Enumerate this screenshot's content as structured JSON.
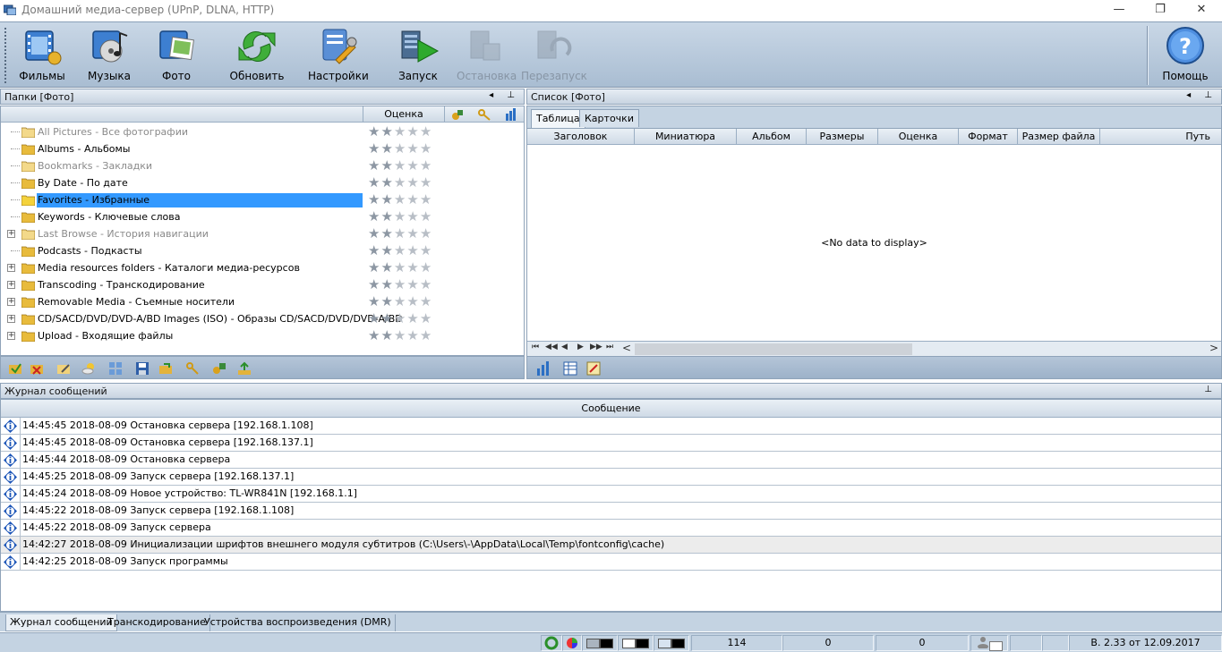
{
  "window": {
    "title": "Домашний медиа-сервер (UPnP, DLNA, HTTP)",
    "minimize": "—",
    "restore": "❐",
    "close": "✕"
  },
  "toolbar": {
    "movies": "Фильмы",
    "music": "Музыка",
    "photo": "Фото",
    "refresh": "Обновить",
    "settings": "Настройки",
    "start": "Запуск",
    "stop": "Остановка",
    "restart": "Перезапуск",
    "help": "Помощь"
  },
  "left_panel": {
    "header": "Папки [Фото]",
    "rating_column": "Оценка",
    "items": [
      {
        "label": "All Pictures - Все фотографии",
        "grey": true,
        "expandable": false,
        "rating": 2
      },
      {
        "label": "Albums - Альбомы",
        "grey": false,
        "expandable": false,
        "rating": 2
      },
      {
        "label": "Bookmarks - Закладки",
        "grey": true,
        "expandable": false,
        "rating": 2
      },
      {
        "label": "By Date - По дате",
        "grey": false,
        "expandable": false,
        "rating": 2
      },
      {
        "label": "Favorites - Избранные",
        "grey": false,
        "expandable": false,
        "rating": 2,
        "selected": true
      },
      {
        "label": "Keywords - Ключевые слова",
        "grey": false,
        "expandable": false,
        "rating": 2
      },
      {
        "label": "Last Browse - История навигации",
        "grey": true,
        "expandable": true,
        "rating": 2
      },
      {
        "label": "Podcasts - Подкасты",
        "grey": false,
        "expandable": false,
        "rating": 2
      },
      {
        "label": "Media resources folders - Каталоги медиа-ресурсов",
        "grey": false,
        "expandable": true,
        "rating": 2
      },
      {
        "label": "Transcoding - Транскодирование",
        "grey": false,
        "expandable": true,
        "rating": 2
      },
      {
        "label": "Removable Media - Съемные носители",
        "grey": false,
        "expandable": true,
        "rating": 2
      },
      {
        "label": "CD/SACD/DVD/DVD-A/BD Images (ISO) - Образы CD/SACD/DVD/DVD-A/BD",
        "grey": false,
        "expandable": true,
        "rating": 2
      },
      {
        "label": "Upload - Входящие файлы",
        "grey": false,
        "expandable": true,
        "rating": 2
      }
    ]
  },
  "right_panel": {
    "header": "Список [Фото]",
    "tabs": [
      "Таблица",
      "Карточки"
    ],
    "columns": [
      "Заголовок",
      "Миниатюра",
      "Альбом",
      "Размеры",
      "Оценка",
      "Формат",
      "Размер файла",
      "Путь"
    ],
    "empty_text": "<No data to display>",
    "nav": [
      "⏮",
      "◀◀",
      "◀",
      "▶",
      "▶▶",
      "⏭",
      "<",
      ">"
    ]
  },
  "log": {
    "header": "Журнал сообщений",
    "column": "Сообщение",
    "rows": [
      "14:45:45 2018-08-09 Остановка сервера [192.168.1.108]",
      "14:45:45 2018-08-09 Остановка сервера [192.168.137.1]",
      "14:45:44 2018-08-09 Остановка сервера",
      "14:45:25 2018-08-09 Запуск сервера [192.168.137.1]",
      "14:45:24 2018-08-09 Новое устройство: TL-WR841N [192.168.1.1]",
      "14:45:22 2018-08-09 Запуск сервера [192.168.1.108]",
      "14:45:22 2018-08-09 Запуск сервера",
      "14:42:27 2018-08-09 Инициализации шрифтов внешнего модуля субтитров (C:\\Users\\-\\AppData\\Local\\Temp\\fontconfig\\cache)",
      "14:42:25 2018-08-09 Запуск программы"
    ],
    "selected_index": 7
  },
  "bottom_tabs": [
    "Журнал сообщений",
    "Транскодирование",
    "Устройства воспроизведения (DMR)"
  ],
  "status": {
    "count1": "114",
    "count2": "0",
    "count3": "0",
    "version": "В. 2.33 от 12.09.2017"
  },
  "colors": {
    "selection": "#3399ff",
    "toolbar_bg": "#b4c5d8",
    "panel_border": "#8fa3b9"
  }
}
